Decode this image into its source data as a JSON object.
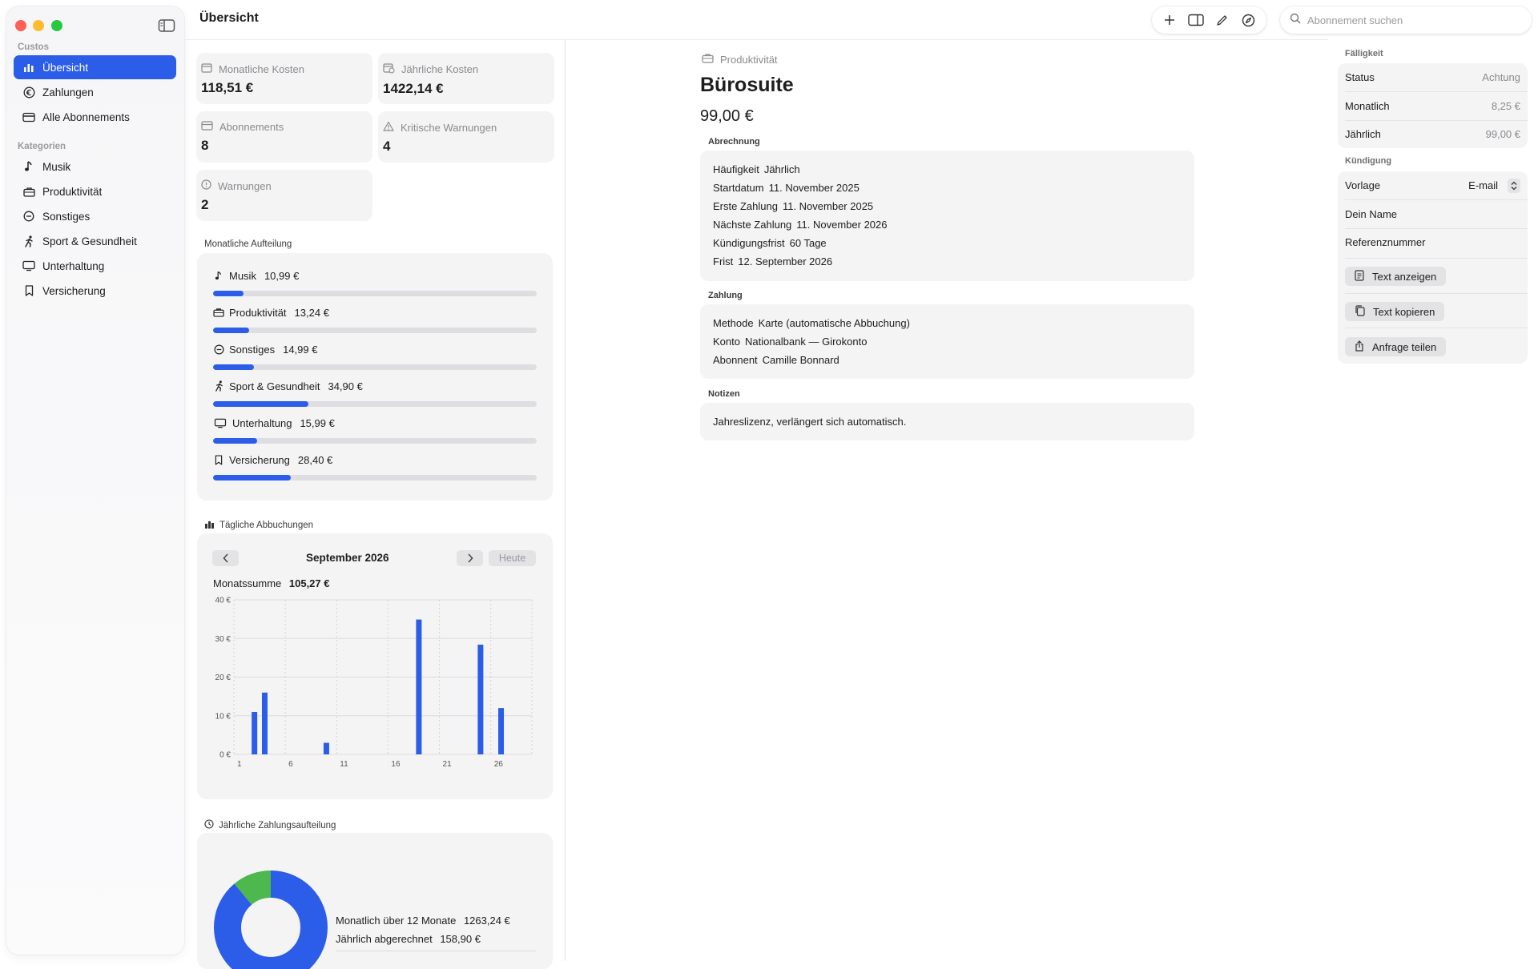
{
  "app": {
    "title": "Übersicht"
  },
  "sidebar": {
    "section_custos": "Custos",
    "section_categories": "Kategorien",
    "nav": [
      {
        "label": "Übersicht",
        "icon": "chart-bar-icon",
        "active": true
      },
      {
        "label": "Zahlungen",
        "icon": "euro-circle-icon"
      },
      {
        "label": "Alle Abonnements",
        "icon": "card-icon"
      }
    ],
    "categories": [
      {
        "label": "Musik",
        "icon": "music-note-icon"
      },
      {
        "label": "Produktivität",
        "icon": "briefcase-icon"
      },
      {
        "label": "Sonstiges",
        "icon": "minus-circle-icon"
      },
      {
        "label": "Sport & Gesundheit",
        "icon": "running-icon"
      },
      {
        "label": "Unterhaltung",
        "icon": "monitor-icon"
      },
      {
        "label": "Versicherung",
        "icon": "bookmark-icon"
      }
    ]
  },
  "search": {
    "placeholder": "Abonnement suchen"
  },
  "stats": {
    "monthly": {
      "label": "Monatliche Kosten",
      "value": "118,51 €"
    },
    "yearly": {
      "label": "Jährliche Kosten",
      "value": "1422,14 €"
    },
    "subs": {
      "label": "Abonnements",
      "value": "8"
    },
    "critical": {
      "label": "Kritische Warnungen",
      "value": "4"
    },
    "warnings": {
      "label": "Warnungen",
      "value": "2"
    }
  },
  "breakdown": {
    "title": "Monatliche Aufteilung",
    "items": [
      {
        "name": "Musik",
        "amount": "10,99 €",
        "fraction": 0.093
      },
      {
        "name": "Produktivität",
        "amount": "13,24 €",
        "fraction": 0.112
      },
      {
        "name": "Sonstiges",
        "amount": "14,99 €",
        "fraction": 0.126
      },
      {
        "name": "Sport & Gesundheit",
        "amount": "34,90 €",
        "fraction": 0.294
      },
      {
        "name": "Unterhaltung",
        "amount": "15,99 €",
        "fraction": 0.135
      },
      {
        "name": "Versicherung",
        "amount": "28,40 €",
        "fraction": 0.24
      }
    ]
  },
  "daily": {
    "title": "Tägliche Abbuchungen",
    "month": "September 2026",
    "today": "Heute",
    "sum_label": "Monatssumme",
    "sum_value": "105,27 €"
  },
  "annual": {
    "title": "Jährliche Zahlungsaufteilung",
    "row1_label": "Monatlich über 12 Monate",
    "row1_value": "1263,24 €",
    "row2_label": "Jährlich abgerechnet",
    "row2_value": "158,90 €"
  },
  "chart_data": [
    {
      "type": "bar",
      "x": [
        3,
        4,
        10,
        19,
        25,
        27
      ],
      "values": [
        10.99,
        15.99,
        2.99,
        34.9,
        28.4,
        11.99
      ],
      "xticks": [
        "1",
        "6",
        "11",
        "16",
        "21",
        "26"
      ],
      "yticks": [
        "0 €",
        "10 €",
        "20 €",
        "30 €",
        "40 €"
      ],
      "xlim": [
        1,
        30
      ],
      "ylim": [
        0,
        40
      ],
      "color": "#2b5de8"
    },
    {
      "type": "pie",
      "labels": [
        "Monatlich über 12 Monate",
        "Jährlich abgerechnet"
      ],
      "values": [
        1263.24,
        158.9
      ],
      "colors": [
        "#2b5de8",
        "#4cb84e"
      ]
    }
  ],
  "detail": {
    "category": "Produktivität",
    "name": "Bürosuite",
    "price": "99,00 €",
    "billing_title": "Abrechnung",
    "billing": [
      {
        "k": "Häufigkeit",
        "v": "Jährlich"
      },
      {
        "k": "Startdatum",
        "v": "11. November 2025"
      },
      {
        "k": "Erste Zahlung",
        "v": "11. November 2025"
      },
      {
        "k": "Nächste Zahlung",
        "v": "11. November 2026"
      },
      {
        "k": "Kündigungsfrist",
        "v": "60 Tage"
      },
      {
        "k": "Frist",
        "v": "12. September 2026"
      }
    ],
    "payment_title": "Zahlung",
    "payment": [
      {
        "k": "Methode",
        "v": "Karte (automatische Abbuchung)"
      },
      {
        "k": "Konto",
        "v": "Nationalbank — Girokonto"
      },
      {
        "k": "Abonnent",
        "v": "Camille Bonnard"
      }
    ],
    "notes_title": "Notizen",
    "notes": "Jahreslizenz, verlängert sich automatisch."
  },
  "inspector": {
    "due_title": "Fälligkeit",
    "status_label": "Status",
    "status_value": "Achtung",
    "monthly_label": "Monatlich",
    "monthly_value": "8,25 €",
    "yearly_label": "Jährlich",
    "yearly_value": "99,00 €",
    "cancel_title": "Kündigung",
    "template_label": "Vorlage",
    "template_value": "E-mail",
    "name_label": "Dein Name",
    "ref_label": "Referenznummer",
    "show_text": "Text anzeigen",
    "copy_text": "Text kopieren",
    "share_request": "Anfrage teilen"
  }
}
